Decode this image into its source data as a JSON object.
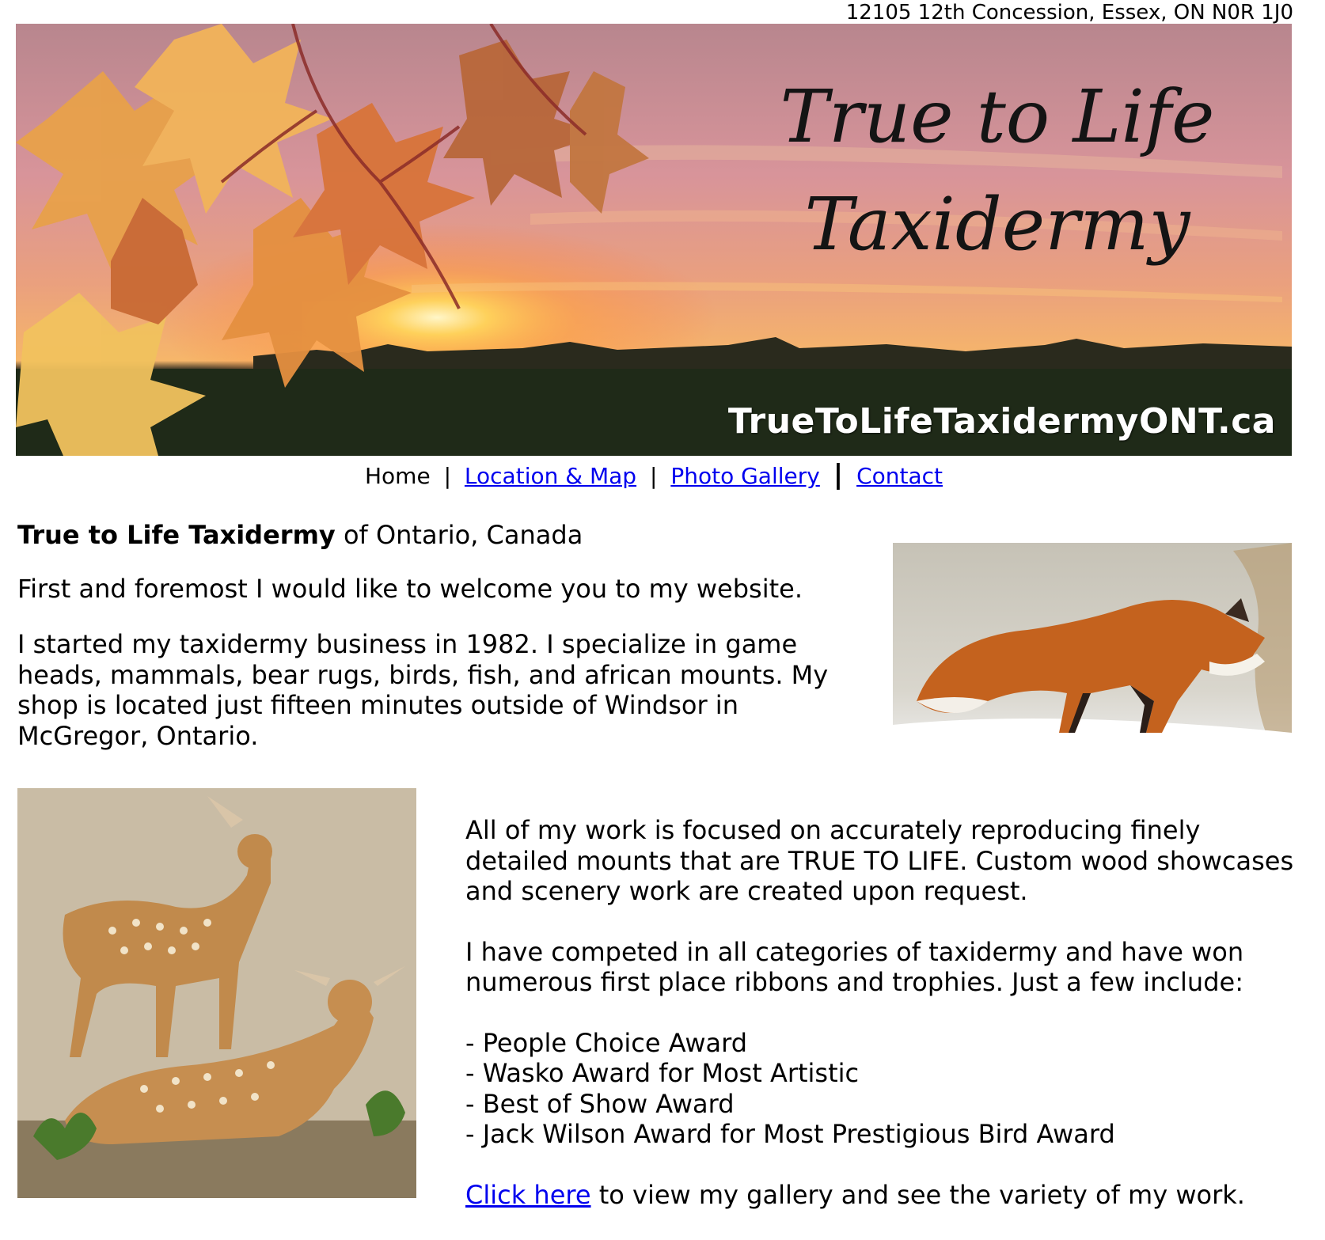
{
  "header": {
    "address": "12105 12th Concession, Essex, ON N0R 1J0"
  },
  "banner": {
    "title_line1": "True to Life",
    "title_line2": "Taxidermy",
    "url_text": "TrueToLifeTaxidermyONT.ca"
  },
  "nav": {
    "items": [
      {
        "label": "Home",
        "is_link": false
      },
      {
        "label": "Location & Map",
        "is_link": true
      },
      {
        "label": "Photo Gallery",
        "is_link": true
      },
      {
        "label": "Contact",
        "is_link": true
      }
    ],
    "separator": "|"
  },
  "intro": {
    "title_bold": "True to Life Taxidermy",
    "title_rest": " of Ontario, Canada",
    "paragraph1": "First and foremost I would like to welcome you to my website.",
    "paragraph2": "I started my taxidermy business in 1982. I specialize in game heads, mammals, bear rugs, birds, fish, and african mounts. My shop is located just fifteen minutes outside of Windsor in McGregor, Ontario."
  },
  "main": {
    "paragraph3": "All of my work is focused on accurately reproducing finely detailed mounts that are TRUE TO LIFE. Custom wood showcases and scenery work are created upon request.",
    "paragraph4": "I have competed in all categories of taxidermy and have won numerous first place ribbons and trophies. Just a few include:",
    "awards": [
      "- People Choice Award",
      "- Wasko Award for Most Artistic",
      "- Best of Show Award",
      "- Jack Wilson Award for Most Prestigious Bird Award"
    ],
    "gallery_link_text": "Click here",
    "gallery_link_rest": " to view my gallery and see the variety of my work."
  },
  "colors": {
    "link": "#0000ee",
    "sunset_sky": "#f2a77a",
    "field": "#1f2a18"
  }
}
